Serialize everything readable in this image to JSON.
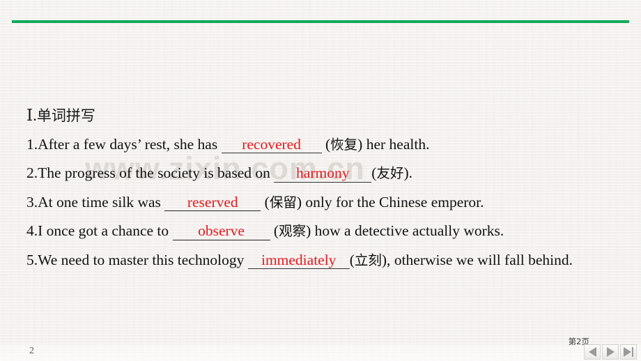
{
  "slide": {
    "accent_color": "#12a95a",
    "answer_color": "#e8181c",
    "background_color": "#f1eeeb",
    "watermark": "www.zixin.com.cn",
    "page_number_bottom_left": "2",
    "page_indicator": "第2页"
  },
  "section": {
    "roman": "Ⅰ",
    "separator": ".",
    "title_cjk": "单词拼写",
    "full_title": "Ⅰ.单词拼写"
  },
  "questions": [
    {
      "number": "1.",
      "before": "After a few days’ rest, she has",
      "answer": "recovered",
      "hint_open": "(",
      "hint": "恢复",
      "hint_close": ")",
      "after": "her health.",
      "blank_width": 132
    },
    {
      "number": "2.",
      "before": "The progress of the society is based on",
      "answer": "harmony",
      "hint_open": "(",
      "hint": "友好",
      "hint_close": ").",
      "after": "",
      "blank_width": 128
    },
    {
      "number": "3.",
      "before": "At one time silk was",
      "answer": "reserved",
      "hint_open": "(",
      "hint": "保留",
      "hint_close": ")",
      "after": "only for the Chinese emperor.",
      "blank_width": 126
    },
    {
      "number": "4.",
      "before": "I once got a chance to",
      "answer": "observe",
      "hint_open": "(",
      "hint": "观察",
      "hint_close": ")",
      "after": "how a detective actually works.",
      "blank_width": 128
    },
    {
      "number": "5.",
      "before": "We need to master this technology",
      "answer": "immediately",
      "hint_open": "(",
      "hint": "立刻",
      "hint_close": "),",
      "after": "otherwise we will fall behind.",
      "blank_width": 134
    }
  ],
  "nav": {
    "prev_label": "previous-slide",
    "play_label": "play-slide",
    "end_label": "last-slide"
  }
}
